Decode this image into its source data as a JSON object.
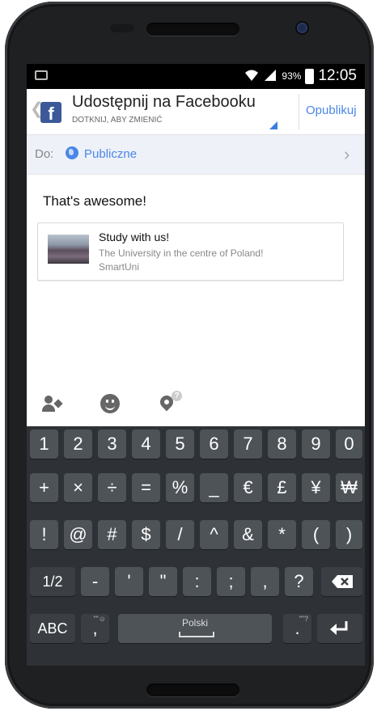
{
  "status_bar": {
    "battery_percent": "93%",
    "time": "12:05",
    "icons": [
      "photo-icon",
      "wifi-icon",
      "signal-icon",
      "battery-icon"
    ]
  },
  "app_bar": {
    "title": "Udostępnij na Facebooku",
    "subtitle": "DOTKNIJ, ABY ZMIENIĆ",
    "publish_label": "Opublikuj",
    "logo_glyph": "f",
    "accent_color": "#4a86e8",
    "brand_color": "#3b5998"
  },
  "audience_row": {
    "label": "Do:",
    "value": "Publiczne"
  },
  "composer": {
    "message": "That's awesome!"
  },
  "link_card": {
    "title": "Study with us!",
    "description": "The University in the centre of Poland!",
    "source": "SmartUni"
  },
  "actions": [
    "tag-people-icon",
    "emoji-icon",
    "location-icon"
  ],
  "keyboard": {
    "row1": [
      "1",
      "2",
      "3",
      "4",
      "5",
      "6",
      "7",
      "8",
      "9",
      "0"
    ],
    "row2": [
      "+",
      "×",
      "÷",
      "=",
      "%",
      "_",
      "€",
      "£",
      "¥",
      "₩"
    ],
    "row3": [
      "!",
      "@",
      "#",
      "$",
      "/",
      "^",
      "&",
      "*",
      "(",
      ")"
    ],
    "row4": [
      "1/2",
      "-",
      "'",
      "\"",
      ":",
      ";",
      ",",
      "?"
    ],
    "abc_label": "ABC",
    "comma_key": ",",
    "space_label": "Polski",
    "period_key": ".",
    "comma_hint": "\"\"☺",
    "period_hint": "\"\"?"
  }
}
